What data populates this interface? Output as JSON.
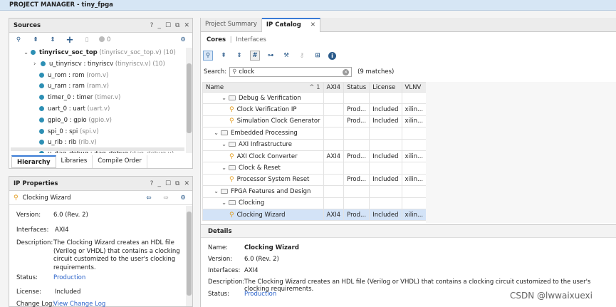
{
  "titlebar": {
    "title": "PROJECT MANAGER - tiny_fpga"
  },
  "sources": {
    "title": "Sources",
    "controls": [
      "?",
      "_",
      "☐",
      "⧉",
      "✕"
    ],
    "count": "0",
    "tree": [
      {
        "label": "tinyriscv_soc_top",
        "detail": "(tinyriscv_soc_top.v) (10)",
        "bold": true
      },
      {
        "label": "u_tinyriscv : tinyriscv",
        "detail": "(tinyriscv.v) (10)"
      },
      {
        "label": "u_rom : rom",
        "detail": "(rom.v)"
      },
      {
        "label": "u_ram : ram",
        "detail": "(ram.v)"
      },
      {
        "label": "timer_0 : timer",
        "detail": "(timer.v)"
      },
      {
        "label": "uart_0 : uart",
        "detail": "(uart.v)"
      },
      {
        "label": "gpio_0 : gpio",
        "detail": "(gpio.v)"
      },
      {
        "label": "spi_0 : spi",
        "detail": "(spi.v)"
      },
      {
        "label": "u_rib : rib",
        "detail": "(rib.v)"
      },
      {
        "label": "u_jtag_debug : jtag_debug",
        "detail": "(jtag_debug.v)"
      }
    ],
    "tabs": [
      "Hierarchy",
      "Libraries",
      "Compile Order"
    ]
  },
  "ip_properties": {
    "title": "IP Properties",
    "controls": [
      "?",
      "_",
      "☐",
      "⧉",
      "✕"
    ],
    "ip_name": "Clocking Wizard",
    "version_label": "Version:",
    "version": "6.0 (Rev. 2)",
    "interfaces_label": "Interfaces:",
    "interfaces": "AXI4",
    "description_label": "Description:",
    "description_lines": [
      "The Clocking Wizard creates an HDL file",
      "(Verilog or VHDL) that contains a clocking",
      "circuit customized to the user's clocking",
      "requirements."
    ],
    "status_label": "Status:",
    "status": "Production",
    "license_label": "License:",
    "license": "Included",
    "changelog_label": "Change Log:",
    "changelog": "View Change Log"
  },
  "catalog": {
    "tabs": [
      "Project Summary",
      "IP Catalog"
    ],
    "subtabs": [
      "Cores",
      "Interfaces"
    ],
    "subtab_sep": "|",
    "search_label": "Search:",
    "search_value": "clock",
    "matches": "(9 matches)",
    "columns": [
      "Name",
      "AXI4",
      "Status",
      "License",
      "VLNV"
    ],
    "sort_indicator": "^ 1",
    "rows": [
      {
        "indent": 2,
        "kind": "folder",
        "name": "Debug & Verification",
        "axi": "",
        "status": "",
        "license": "",
        "vlnv": ""
      },
      {
        "indent": 3,
        "kind": "ip",
        "name": "Clock Verification IP",
        "axi": "",
        "status": "Prod...",
        "license": "Included",
        "vlnv": "xilin..."
      },
      {
        "indent": 3,
        "kind": "ip",
        "name": "Simulation Clock Generator",
        "axi": "",
        "status": "Prod...",
        "license": "Included",
        "vlnv": "xilin..."
      },
      {
        "indent": 1,
        "kind": "folder",
        "name": "Embedded Processing",
        "axi": "",
        "status": "",
        "license": "",
        "vlnv": ""
      },
      {
        "indent": 2,
        "kind": "folder",
        "name": "AXI Infrastructure",
        "axi": "",
        "status": "",
        "license": "",
        "vlnv": ""
      },
      {
        "indent": 3,
        "kind": "ip",
        "name": "AXI Clock Converter",
        "axi": "AXI4",
        "status": "Prod...",
        "license": "Included",
        "vlnv": "xilin..."
      },
      {
        "indent": 2,
        "kind": "folder",
        "name": "Clock & Reset",
        "axi": "",
        "status": "",
        "license": "",
        "vlnv": ""
      },
      {
        "indent": 3,
        "kind": "ip",
        "name": "Processor System Reset",
        "axi": "",
        "status": "Prod...",
        "license": "Included",
        "vlnv": "xilin..."
      },
      {
        "indent": 1,
        "kind": "folder",
        "name": "FPGA Features and Design",
        "axi": "",
        "status": "",
        "license": "",
        "vlnv": ""
      },
      {
        "indent": 2,
        "kind": "folder",
        "name": "Clocking",
        "axi": "",
        "status": "",
        "license": "",
        "vlnv": ""
      },
      {
        "indent": 3,
        "kind": "ip",
        "name": "Clocking Wizard",
        "axi": "AXI4",
        "status": "Prod...",
        "license": "Included",
        "vlnv": "xilin...",
        "selected": true
      }
    ]
  },
  "details": {
    "title": "Details",
    "name_label": "Name:",
    "name": "Clocking Wizard",
    "version_label": "Version:",
    "version": "6.0 (Rev. 2)",
    "interfaces_label": "Interfaces:",
    "interfaces": "AXI4",
    "description_label": "Description:",
    "description": "The Clocking Wizard creates an HDL file (Verilog or VHDL) that contains a clocking circuit customized to the user's clocking requirements.",
    "status_label": "Status:",
    "status": "Production"
  },
  "watermark": "CSDN @lwwaixuexi"
}
